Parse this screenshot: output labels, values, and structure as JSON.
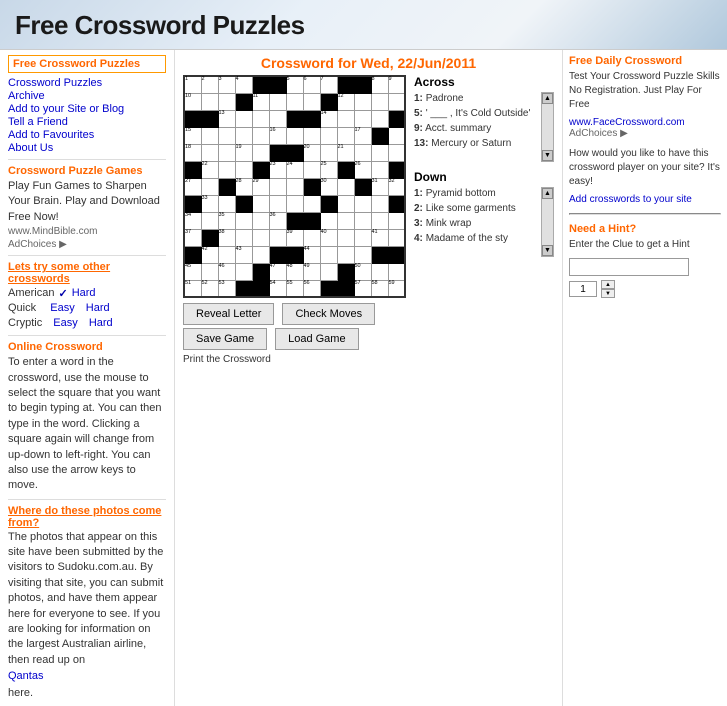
{
  "header": {
    "title": "Free Crossword Puzzles"
  },
  "sidebar": {
    "title": "Free Crossword Puzzles",
    "nav_links": [
      "Crossword Puzzles",
      "Archive",
      "Add to your Site or Blog",
      "Tell a Friend",
      "Add to Favourites",
      "About Us"
    ],
    "games_title": "Crossword Puzzle Games",
    "games_text": "Play Fun Games to Sharpen Your Brain. Play and Download Free Now!",
    "games_url": "www.MindBible.com",
    "ad_choices": "AdChoices",
    "other_cw_title": "Lets try some other crosswords",
    "difficulty": {
      "american": "American",
      "quick": "Quick",
      "cryptic": "Cryptic",
      "easy": "Easy",
      "hard": "Hard"
    },
    "online_cw_title": "Online Crossword",
    "online_cw_text": "To enter a word in the crossword, use the mouse to select the square that you want to begin typing at. You can then type in the word. Clicking a square again will change from up-down to left-right. You can also use the arrow keys to move.",
    "photos_title": "Where do these photos come from?",
    "photos_text": "The photos that appear on this site have been submitted by the visitors to Sudoku.com.au. By visiting that site, you can submit photos, and have them appear here for everyone to see. If you are looking for information on the largest Australian airline, then read up on",
    "photos_link": "Qantas",
    "photos_end": "here."
  },
  "crossword": {
    "title": "Crossword for Wed, 22/Jun/2011",
    "grid_size": 13,
    "buttons": {
      "reveal": "Reveal Letter",
      "check": "Check Moves",
      "save": "Save Game",
      "load": "Load Game"
    }
  },
  "clues": {
    "across_title": "Across",
    "down_title": "Down",
    "across": [
      {
        "num": "1",
        "text": "Padrone"
      },
      {
        "num": "5",
        "text": "' ___ , It's Cold Outside'"
      },
      {
        "num": "9",
        "text": "Acct. summary"
      },
      {
        "num": "13",
        "text": "Mercury or Saturn"
      }
    ],
    "down": [
      {
        "num": "1",
        "text": "Pyramid bottom"
      },
      {
        "num": "2",
        "text": "Like some garments"
      },
      {
        "num": "3",
        "text": "Mink wrap"
      },
      {
        "num": "4",
        "text": "Madame of the sty"
      }
    ]
  },
  "right_panel": {
    "hint_title": "Need a Hint?",
    "hint_text": "Enter the Clue to get a Hint",
    "daily_title": "Free Daily Crossword",
    "daily_text": "Test Your Crossword Puzzle Skills No Registration. Just Play For Free",
    "daily_url": "www.FaceCrossword.com",
    "ad_choices": "AdChoices",
    "add_cw_text": "How would you like to have this crossword player on your site? It's easy!",
    "add_cw_link": "Add crosswords to your site"
  },
  "colors": {
    "orange": "#ff6600",
    "blue_link": "#0000cc",
    "black": "#000000",
    "grid_black": "#000000",
    "header_text": "#1a1a1a"
  }
}
